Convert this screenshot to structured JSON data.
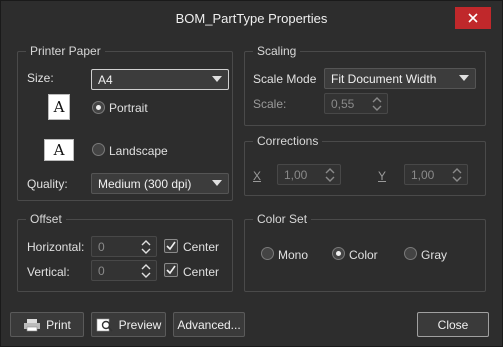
{
  "window": {
    "title": "BOM_PartType Properties"
  },
  "printer_paper": {
    "group_title": "Printer Paper",
    "size_label": "Size:",
    "size_value": "A4",
    "portrait_label": "Portrait",
    "landscape_label": "Landscape",
    "orientation_selected": "Portrait",
    "doc_icon_glyph": "A",
    "quality_label": "Quality:",
    "quality_value": "Medium (300 dpi)"
  },
  "offset": {
    "group_title": "Offset",
    "horizontal_label": "Horizontal:",
    "horizontal_value": "0",
    "vertical_label": "Vertical:",
    "vertical_value": "0",
    "center_label": "Center",
    "horizontal_center_checked": true,
    "vertical_center_checked": true
  },
  "scaling": {
    "group_title": "Scaling",
    "mode_label": "Scale Mode",
    "mode_value": "Fit Document Width",
    "scale_label": "Scale:",
    "scale_value": "0,55"
  },
  "corrections": {
    "group_title": "Corrections",
    "x_label": "X",
    "x_value": "1,00",
    "y_label": "Y",
    "y_value": "1,00"
  },
  "color_set": {
    "group_title": "Color Set",
    "options": [
      "Mono",
      "Color",
      "Gray"
    ],
    "selected": "Color"
  },
  "buttons": {
    "print": "Print",
    "preview": "Preview",
    "advanced": "Advanced...",
    "close": "Close"
  },
  "colors": {
    "close_accent": "#c0282b",
    "background": "#2d2d2d"
  }
}
